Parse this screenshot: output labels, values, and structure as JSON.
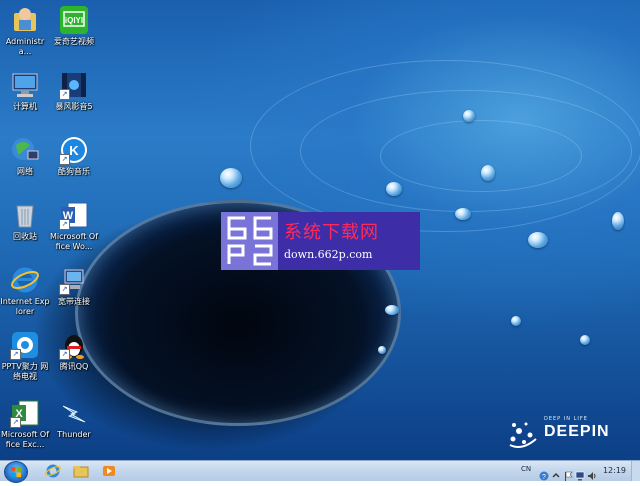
{
  "desktop": {
    "icons_col1": [
      {
        "label": "Administra...",
        "icon": "user-folder-icon"
      },
      {
        "label": "计算机",
        "icon": "computer-icon"
      },
      {
        "label": "网络",
        "icon": "network-icon"
      },
      {
        "label": "回收站",
        "icon": "recycle-bin-icon"
      },
      {
        "label": "Internet Explorer",
        "icon": "internet-explorer-icon"
      },
      {
        "label": "PPTV聚力 网络电视",
        "icon": "pptv-icon"
      },
      {
        "label": "Microsoft Office Exc...",
        "icon": "excel-icon"
      }
    ],
    "icons_col2": [
      {
        "label": "爱奇艺视频",
        "icon": "iqiyi-icon"
      },
      {
        "label": "暴风影音5",
        "icon": "baofeng-icon"
      },
      {
        "label": "酷狗音乐",
        "icon": "kugou-icon"
      },
      {
        "label": "Microsoft Office Wo...",
        "icon": "word-icon"
      },
      {
        "label": "宽带连接",
        "icon": "broadband-icon"
      },
      {
        "label": "腾讯QQ",
        "icon": "qq-icon"
      },
      {
        "label": "Thunder",
        "icon": "thunder-icon"
      }
    ]
  },
  "watermark": {
    "logo_text": "662P",
    "title": "系统下载网",
    "url": "down.662p.com"
  },
  "branding": {
    "tagline": "DEEP IN LIFE",
    "name": "DEEPIN"
  },
  "taskbar": {
    "pinned": [
      "internet-explorer-icon",
      "explorer-folder-icon",
      "media-player-icon"
    ],
    "tray": {
      "ime": "CN",
      "clock": "12:19"
    }
  },
  "colors": {
    "watermark_bg": "#3d2ea8",
    "watermark_title": "#ff2a5a",
    "taskbar": "#c3d6ec"
  }
}
